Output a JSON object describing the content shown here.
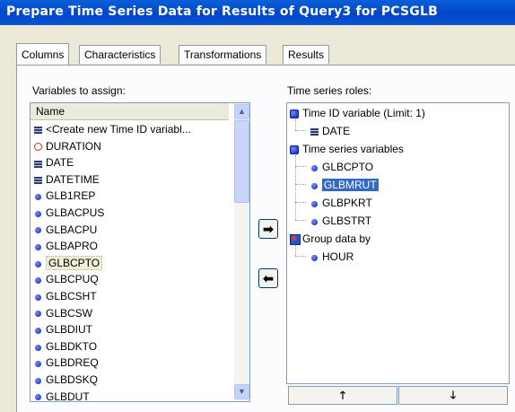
{
  "window": {
    "title": "Prepare Time Series Data for Results of Query3 for PCSGLB"
  },
  "tabs": [
    "Columns",
    "Characteristics",
    "Transformations",
    "Results"
  ],
  "left": {
    "label": "Variables to assign:",
    "header": "Name",
    "items": [
      {
        "text": "<Create new Time ID variabl...",
        "icon": "table-icon"
      },
      {
        "text": "DURATION",
        "icon": "clock-icon"
      },
      {
        "text": "DATE",
        "icon": "table-icon"
      },
      {
        "text": "DATETIME",
        "icon": "table-icon"
      },
      {
        "text": "GLB1REP",
        "icon": "numeric-dot-icon"
      },
      {
        "text": "GLBACPUS",
        "icon": "numeric-dot-icon"
      },
      {
        "text": "GLBACPU",
        "icon": "numeric-dot-icon"
      },
      {
        "text": "GLBAPRO",
        "icon": "numeric-dot-icon"
      },
      {
        "text": "GLBCPTO",
        "icon": "numeric-dot-icon"
      },
      {
        "text": "GLBCPUQ",
        "icon": "numeric-dot-icon"
      },
      {
        "text": "GLBCSHT",
        "icon": "numeric-dot-icon"
      },
      {
        "text": "GLBCSW",
        "icon": "numeric-dot-icon"
      },
      {
        "text": "GLBDIUT",
        "icon": "numeric-dot-icon"
      },
      {
        "text": "GLBDKTO",
        "icon": "numeric-dot-icon"
      },
      {
        "text": "GLBDREQ",
        "icon": "numeric-dot-icon"
      },
      {
        "text": "GLBDSKQ",
        "icon": "numeric-dot-icon"
      },
      {
        "text": "GLBDUT",
        "icon": "numeric-dot-icon"
      }
    ]
  },
  "right": {
    "label": "Time series roles:",
    "time_id_label": "Time ID variable  (Limit: 1)",
    "time_id_items": [
      "DATE"
    ],
    "ts_label": "Time series variables",
    "ts_items": [
      "GLBCPTO",
      "GLBMRUT",
      "GLBPKRT",
      "GLBSTRT"
    ],
    "group_label": "Group data by",
    "group_items": [
      "HOUR"
    ]
  },
  "buttons": {
    "add": "➡",
    "remove": "⬅",
    "up": "🡑",
    "down": "🡓"
  },
  "colors": {
    "title_bar": "#0a55d0",
    "selection": "#316ac5"
  }
}
